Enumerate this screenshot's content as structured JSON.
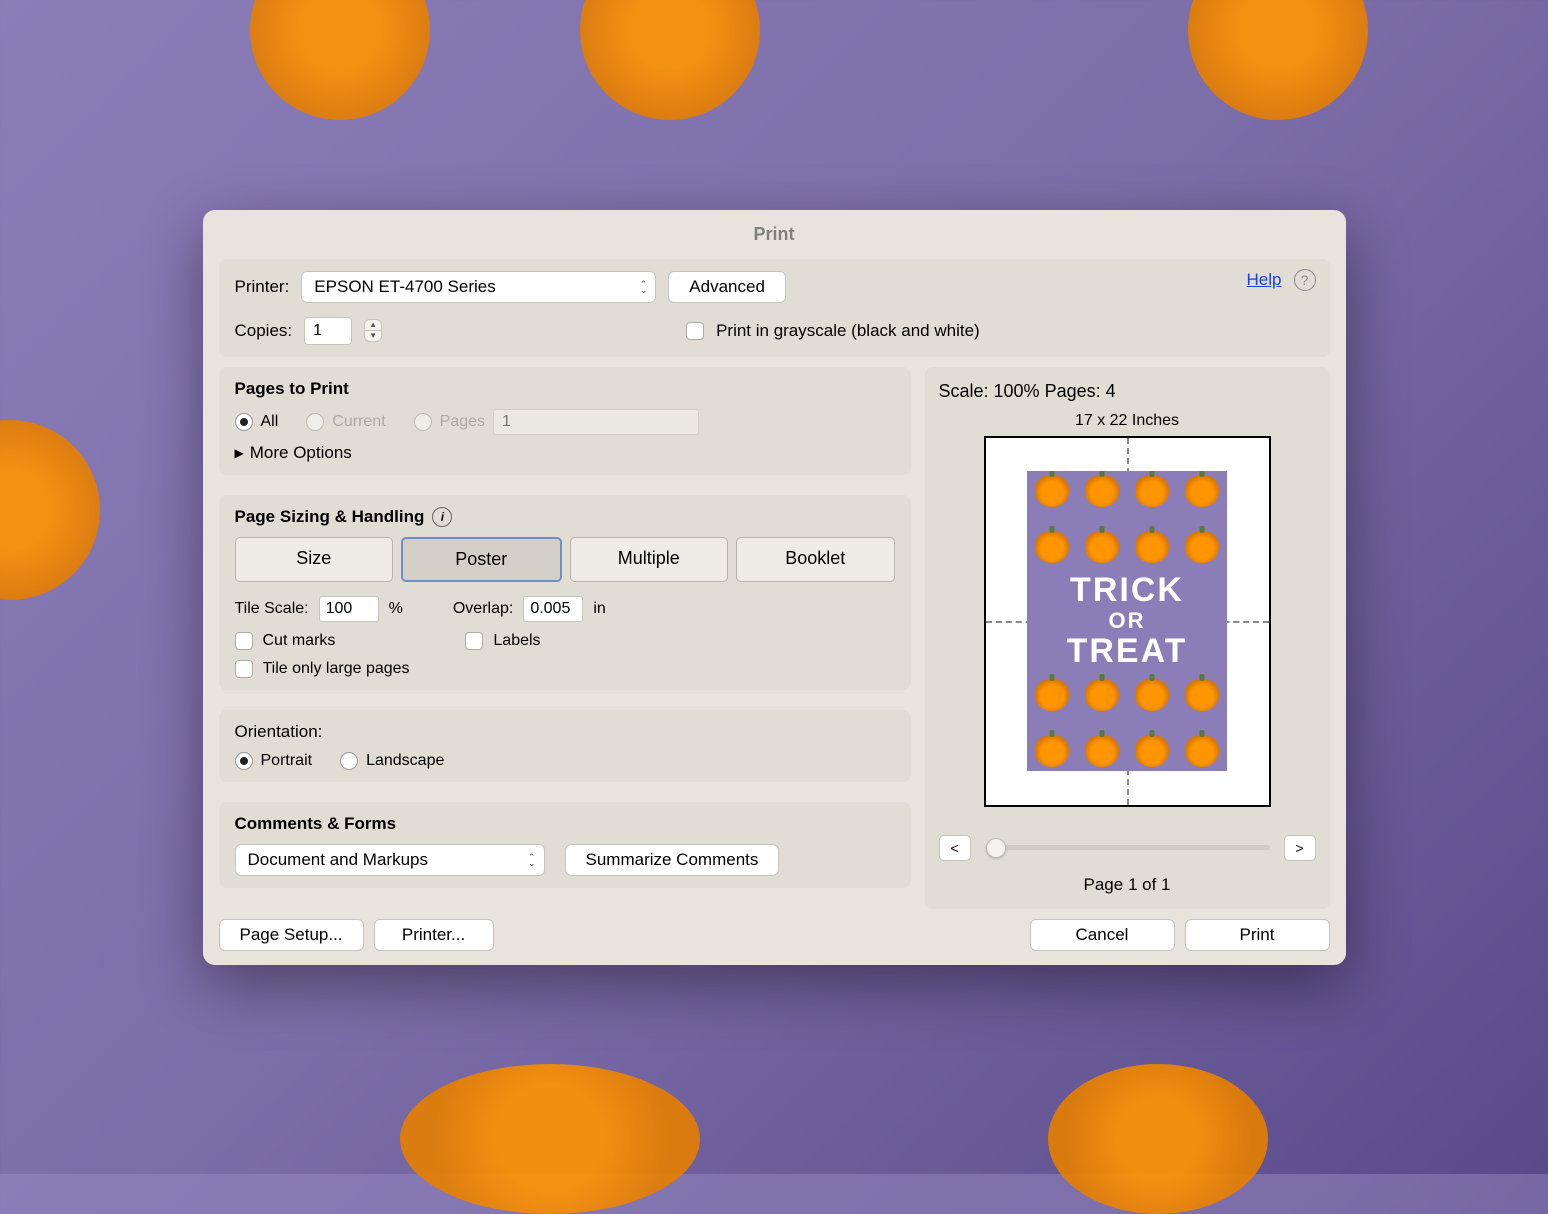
{
  "dialog": {
    "title": "Print"
  },
  "top": {
    "printer_label": "Printer:",
    "printer_value": "EPSON ET-4700 Series",
    "advanced_label": "Advanced",
    "help_label": "Help",
    "copies_label": "Copies:",
    "copies_value": "1",
    "grayscale_label": "Print in grayscale (black and white)"
  },
  "pages": {
    "title": "Pages to Print",
    "all_label": "All",
    "current_label": "Current",
    "pages_label": "Pages",
    "pages_range_placeholder": "1",
    "more_options_label": "More Options"
  },
  "sizing": {
    "title": "Page Sizing & Handling",
    "size_label": "Size",
    "poster_label": "Poster",
    "multiple_label": "Multiple",
    "booklet_label": "Booklet",
    "tile_scale_label": "Tile Scale:",
    "tile_scale_value": "100",
    "tile_scale_unit": "%",
    "overlap_label": "Overlap:",
    "overlap_value": "0.005",
    "overlap_unit": "in",
    "cut_marks_label": "Cut marks",
    "labels_label": "Labels",
    "tile_only_label": "Tile only large pages"
  },
  "orientation": {
    "title": "Orientation:",
    "portrait_label": "Portrait",
    "landscape_label": "Landscape"
  },
  "comments": {
    "title": "Comments & Forms",
    "select_value": "Document and Markups",
    "summarize_label": "Summarize Comments"
  },
  "preview": {
    "status": "Scale: 100% Pages: 4",
    "dimensions": "17 x 22 Inches",
    "poster_line1": "TRICK",
    "poster_line2": "OR",
    "poster_line3": "TREAT",
    "prev_label": "<",
    "next_label": ">",
    "page_indicator": "Page 1 of 1"
  },
  "footer": {
    "page_setup_label": "Page Setup...",
    "printer_label": "Printer...",
    "cancel_label": "Cancel",
    "print_label": "Print"
  }
}
